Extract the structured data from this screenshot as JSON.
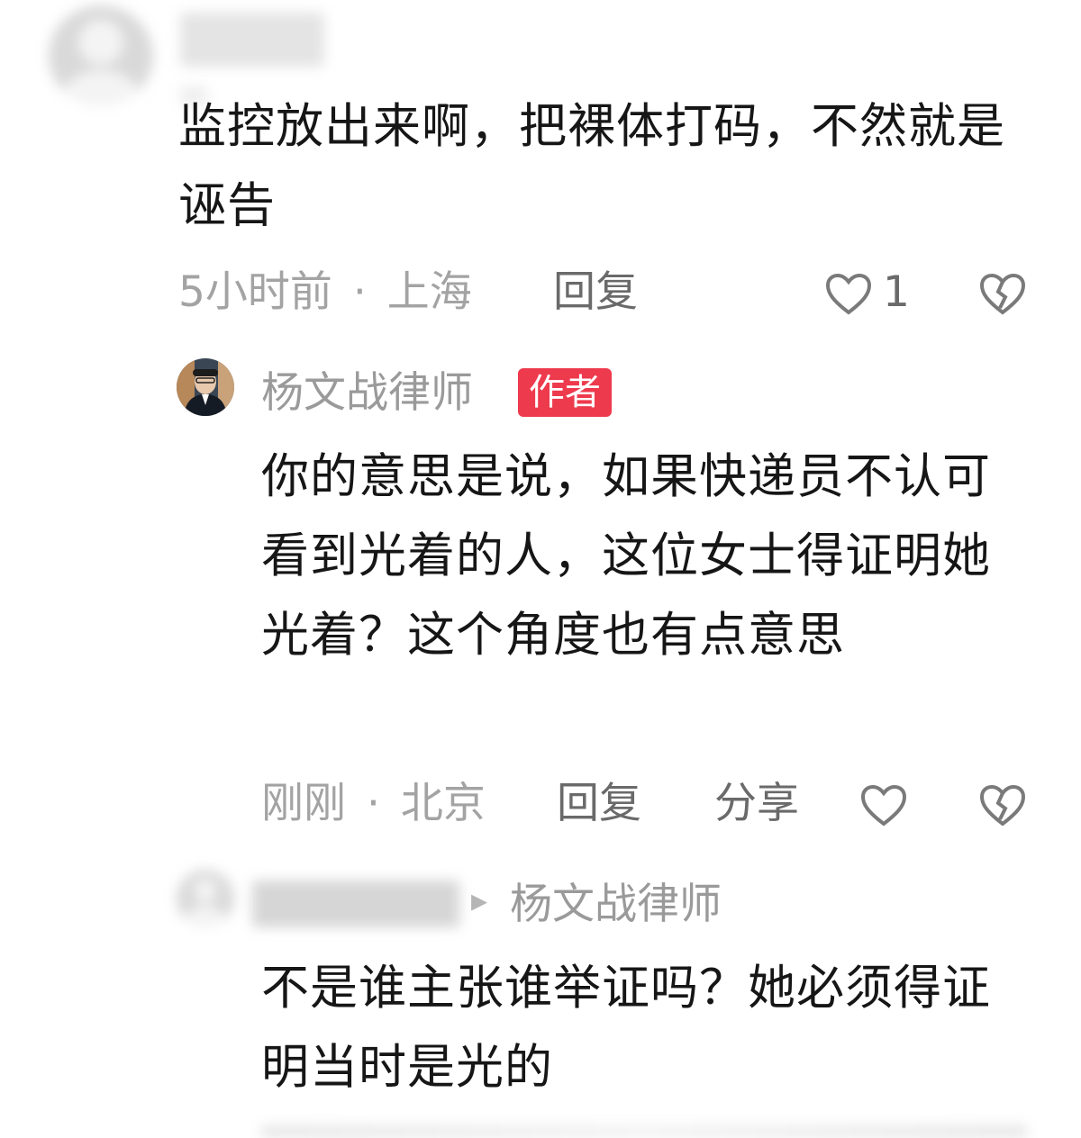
{
  "comments": [
    {
      "user_name": "",
      "text": "监控放出来啊，把裸体打码，不然就是诬告",
      "time": "5小时前",
      "location": "上海",
      "reply_label": "回复",
      "like_count": "1"
    }
  ],
  "replies": [
    {
      "user_name": "杨文战律师",
      "author_badge": "作者",
      "text": "你的意思是说，如果快递员不认可看到光着的人，这位女士得证明她光着？这个角度也有点意思",
      "time": "刚刚",
      "location": "北京",
      "reply_label": "回复",
      "share_label": "分享"
    },
    {
      "user_name": "",
      "reply_to_arrow": "▸",
      "reply_to_name": "杨文战律师",
      "text": "不是谁主张谁举证吗？她必须得证明当时是光的"
    }
  ],
  "separator": "·",
  "icons": {
    "like": "heart-outline-icon",
    "dislike": "broken-heart-icon"
  },
  "colors": {
    "badge": "#ee3a4d",
    "meta": "#a3a3a3",
    "text": "#161616"
  }
}
